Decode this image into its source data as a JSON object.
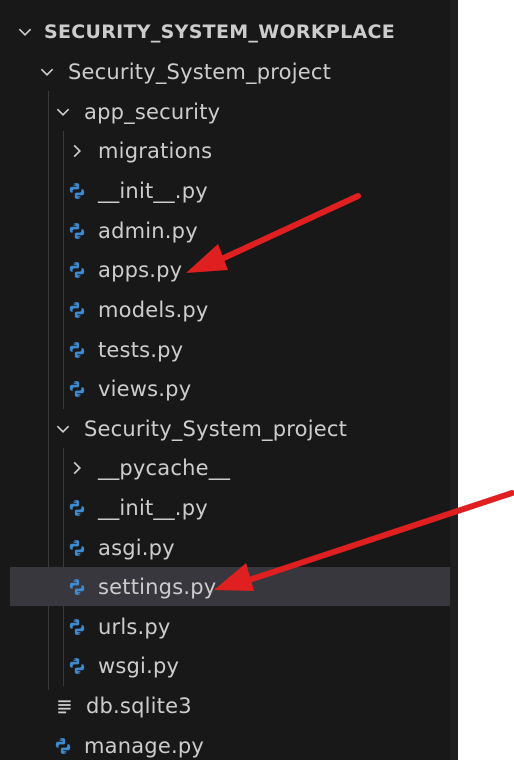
{
  "explorer": {
    "workspace_label": "SECURITY_SYSTEM_WORKPLACE",
    "items": [
      {
        "label": "Security_System_project",
        "kind": "folder",
        "state": "expanded"
      },
      {
        "label": "app_security",
        "kind": "folder",
        "state": "expanded"
      },
      {
        "label": "migrations",
        "kind": "folder",
        "state": "collapsed"
      },
      {
        "label": "__init__.py",
        "kind": "python-file"
      },
      {
        "label": "admin.py",
        "kind": "python-file"
      },
      {
        "label": "apps.py",
        "kind": "python-file"
      },
      {
        "label": "models.py",
        "kind": "python-file"
      },
      {
        "label": "tests.py",
        "kind": "python-file"
      },
      {
        "label": "views.py",
        "kind": "python-file"
      },
      {
        "label": "Security_System_project",
        "kind": "folder",
        "state": "expanded"
      },
      {
        "label": "__pycache__",
        "kind": "folder",
        "state": "collapsed"
      },
      {
        "label": "__init__.py",
        "kind": "python-file"
      },
      {
        "label": "asgi.py",
        "kind": "python-file"
      },
      {
        "label": "settings.py",
        "kind": "python-file",
        "selected": true
      },
      {
        "label": "urls.py",
        "kind": "python-file"
      },
      {
        "label": "wsgi.py",
        "kind": "python-file"
      },
      {
        "label": "db.sqlite3",
        "kind": "database-file"
      },
      {
        "label": "manage.py",
        "kind": "python-file"
      }
    ]
  },
  "colors": {
    "sidebar_bg": "#181818",
    "selected_row_bg": "#37373d",
    "text": "#cccccc",
    "python_icon": "#3e8ad0",
    "annotation_arrow": "#e02020"
  },
  "icons": {
    "expanded": "chevron-down-icon",
    "collapsed": "chevron-right-icon",
    "python": "python-file-icon",
    "database": "lines-file-icon"
  }
}
